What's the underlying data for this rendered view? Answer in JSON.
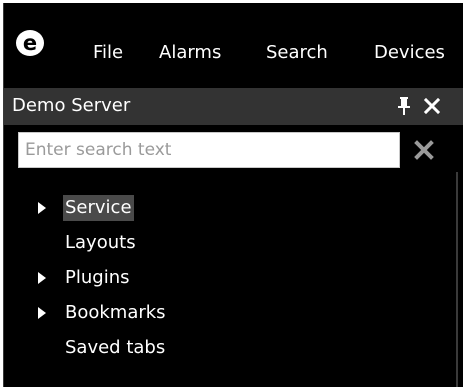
{
  "menubar": {
    "logo_letter": "e",
    "items": [
      {
        "label": "File"
      },
      {
        "label": "Alarms"
      },
      {
        "label": "Search"
      },
      {
        "label": "Devices"
      }
    ]
  },
  "panel": {
    "title": "Demo Server",
    "search": {
      "placeholder": "Enter search text",
      "value": ""
    },
    "tree": [
      {
        "label": "Service",
        "expandable": true,
        "selected": true
      },
      {
        "label": "Layouts",
        "expandable": false,
        "selected": false
      },
      {
        "label": "Plugins",
        "expandable": true,
        "selected": false
      },
      {
        "label": "Bookmarks",
        "expandable": true,
        "selected": false
      },
      {
        "label": "Saved tabs",
        "expandable": false,
        "selected": false
      }
    ]
  },
  "icons": {
    "logo": "app-logo-icon",
    "pin": "pin-icon",
    "close": "close-icon",
    "clear": "clear-search-icon",
    "expand": "expand-arrow-icon"
  },
  "colors": {
    "background": "#000000",
    "panel_header": "#333333",
    "selection": "#4a4a4a",
    "text": "#ffffff",
    "icon_gray": "#9a9a9a"
  }
}
